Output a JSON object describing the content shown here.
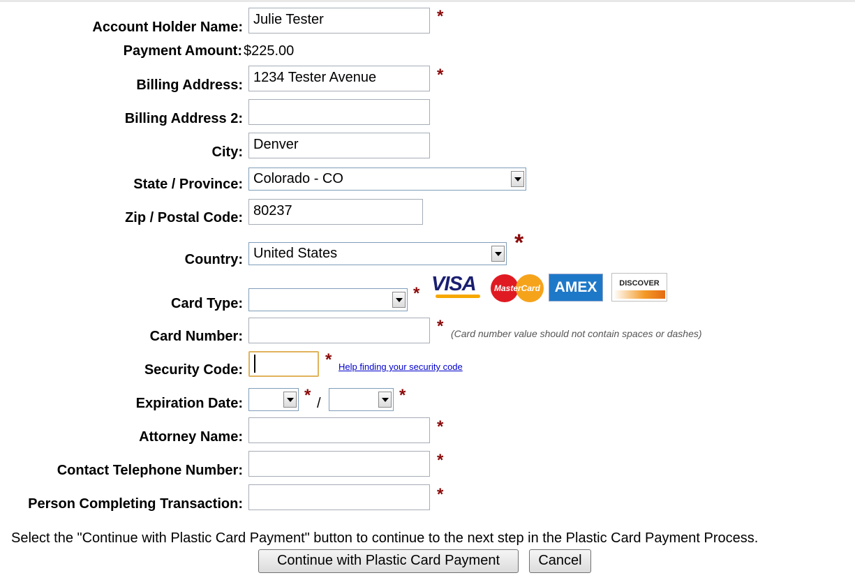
{
  "form": {
    "account_holder_label": "Account Holder Name:",
    "account_holder_value": "Julie Tester",
    "payment_amount_label": "Payment Amount:",
    "payment_amount_value": "$225.00",
    "billing_address_label": "Billing Address:",
    "billing_address_value": "1234 Tester Avenue",
    "billing_address2_label": "Billing Address 2:",
    "billing_address2_value": "",
    "city_label": "City:",
    "city_value": "Denver",
    "state_label": "State / Province:",
    "state_value": "Colorado - CO",
    "zip_label": "Zip / Postal Code:",
    "zip_value": "80237",
    "country_label": "Country:",
    "country_value": "United States",
    "card_type_label": "Card Type:",
    "card_type_value": "",
    "card_number_label": "Card Number:",
    "card_number_value": "",
    "card_number_hint": "(Card number value should not contain spaces or dashes)",
    "security_code_label": "Security Code:",
    "security_code_value": "",
    "security_help_link": "Help finding your security code",
    "expiration_label": "Expiration Date:",
    "expiration_month_value": "",
    "expiration_year_value": "",
    "expiration_separator": "/",
    "attorney_label": "Attorney Name:",
    "attorney_value": "",
    "phone_label": "Contact Telephone Number:",
    "phone_value": "",
    "person_label": "Person Completing Transaction:",
    "person_value": "",
    "required_marker": "*"
  },
  "card_logos": {
    "visa": "VISA",
    "mastercard": "MasterCard",
    "amex": "AMEX",
    "discover": "DISCOVER"
  },
  "footer": {
    "instruction": "Select the \"Continue with Plastic Card Payment\" button to continue to the next step in the Plastic Card Payment Process.",
    "continue_button": "Continue with Plastic Card Payment",
    "cancel_button": "Cancel"
  },
  "colors": {
    "required": "#8b0a0a",
    "focus_border": "#e0b25b",
    "link": "#0000cc"
  }
}
